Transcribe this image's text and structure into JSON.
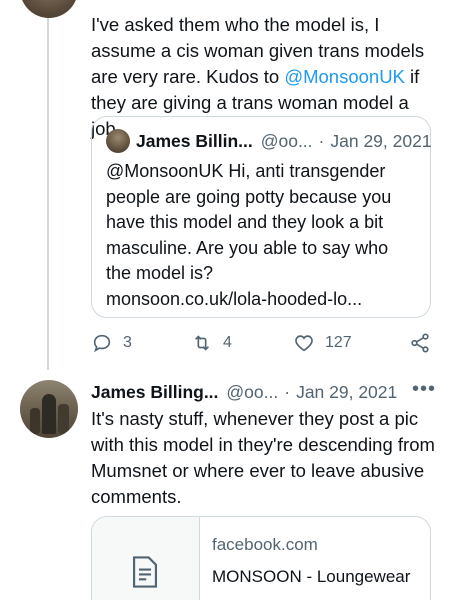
{
  "tweet1": {
    "text_before": "I've asked them who the model is, I assume a cis woman given trans models are very rare. Kudos to ",
    "mention": "@MonsoonUK",
    "text_after": " if they are giving a trans woman model a job."
  },
  "quote": {
    "name": "James Billin...",
    "handle": "@oo...",
    "sep": "·",
    "date": "Jan 29, 2021",
    "text": "@MonsoonUK Hi, anti transgender people are going potty because you have this model and they look a bit masculine. Are you able to say who the model is?",
    "link": "monsoon.co.uk/lola-hooded-lo..."
  },
  "actions": {
    "reply_count": "3",
    "retweet_count": "4",
    "like_count": "127"
  },
  "tweet2": {
    "name": "James Billing...",
    "handle": "@oo...",
    "sep": "·",
    "date": "Jan 29, 2021",
    "more": "•••",
    "text": "It's nasty stuff, whenever they post a pic with this model in they're descending from Mumsnet or where ever to leave abusive comments."
  },
  "card": {
    "domain": "facebook.com",
    "title": "MONSOON - Loungewear"
  },
  "icons": {
    "reply": "reply-icon",
    "retweet": "retweet-icon",
    "like": "like-icon",
    "share": "share-icon",
    "document": "document-icon"
  },
  "colors": {
    "accent": "#1d9bf0",
    "text": "#0f1419",
    "muted": "#536471",
    "border": "#cfd9de"
  }
}
